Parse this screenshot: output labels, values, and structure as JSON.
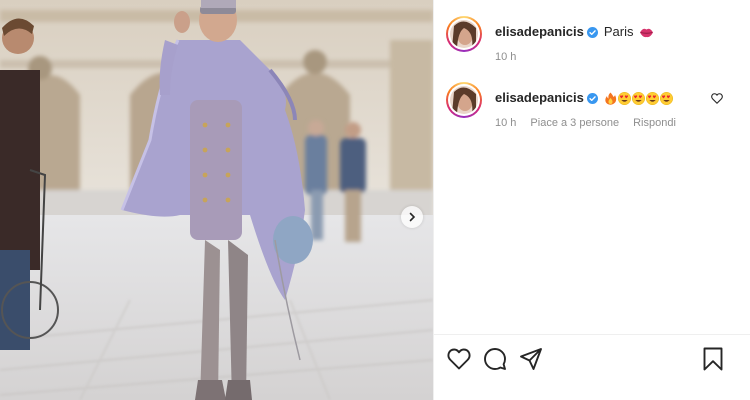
{
  "post": {
    "media": {
      "has_next": true
    },
    "caption": {
      "username": "elisadepanicis",
      "verified": true,
      "text": "Paris",
      "emoji": [
        "lips"
      ],
      "time": "10 h"
    },
    "comments": [
      {
        "username": "elisadepanicis",
        "verified": true,
        "emoji": [
          "fire",
          "heart-eyes",
          "heart-eyes",
          "heart-eyes",
          "heart-eyes"
        ],
        "time": "10 h",
        "likes": "Piace a 3 persone",
        "reply": "Rispondi"
      }
    ],
    "actions": [
      "like-icon",
      "comment-icon",
      "share-icon",
      "save-icon"
    ]
  },
  "colors": {
    "verified": "#3897f0",
    "text": "#262626",
    "muted": "#8e8e8e",
    "lips": "#d6336c"
  }
}
